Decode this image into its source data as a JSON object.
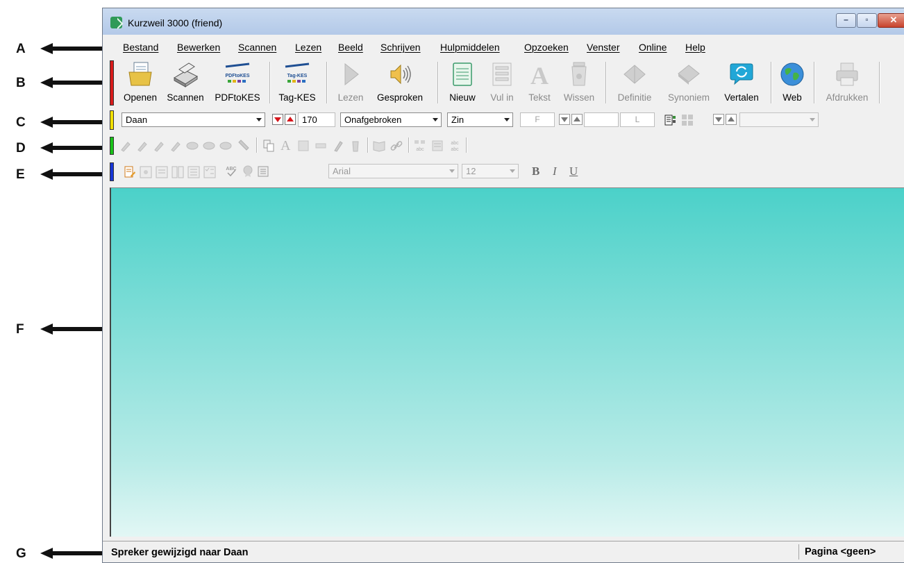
{
  "annotations": [
    "A",
    "B",
    "C",
    "D",
    "E",
    "F",
    "G"
  ],
  "window": {
    "title": "Kurzweil 3000 (friend)"
  },
  "menu": [
    "Bestand",
    "Bewerken",
    "Scannen",
    "Lezen",
    "Beeld",
    "Schrijven",
    "Hulpmiddelen",
    "Opzoeken",
    "Venster",
    "Online",
    "Help"
  ],
  "toolbar": {
    "buttons": [
      {
        "label": "Openen",
        "icon": "open-folder-icon",
        "enabled": true
      },
      {
        "label": "Scannen",
        "icon": "scanner-icon",
        "enabled": true
      },
      {
        "label": "PDFtoKES",
        "icon": "pdftokes-icon",
        "icon_text": "PDFtoKES",
        "enabled": true
      },
      {
        "label": "Tag-KES",
        "icon": "tagkes-icon",
        "icon_text": "Tag-KES",
        "enabled": true
      },
      {
        "label": "Lezen",
        "icon": "play-icon",
        "enabled": false
      },
      {
        "label": "Gesproken",
        "icon": "speaker-icon",
        "enabled": true
      },
      {
        "label": "Nieuw",
        "icon": "new-document-icon",
        "enabled": true
      },
      {
        "label": "Vul in",
        "icon": "fill-in-icon",
        "enabled": false
      },
      {
        "label": "Tekst",
        "icon": "text-icon",
        "enabled": false
      },
      {
        "label": "Wissen",
        "icon": "trash-icon",
        "enabled": false
      },
      {
        "label": "Definitie",
        "icon": "definition-icon",
        "enabled": false
      },
      {
        "label": "Synoniem",
        "icon": "synonym-icon",
        "enabled": false
      },
      {
        "label": "Vertalen",
        "icon": "translate-icon",
        "enabled": true
      },
      {
        "label": "Web",
        "icon": "globe-icon",
        "enabled": true
      },
      {
        "label": "Afdrukken",
        "icon": "printer-icon",
        "enabled": false
      }
    ]
  },
  "reading": {
    "voice": "Daan",
    "speed": "170",
    "mode": "Onafgebroken",
    "unit": "Zin",
    "field_f": "F",
    "field_l": "L"
  },
  "formatting": {
    "font": "Arial",
    "size": "12",
    "bold": "B",
    "italic": "I",
    "underline": "U"
  },
  "status": {
    "message": "Spreker gewijzigd naar Daan",
    "page": "Pagina <geen>"
  },
  "colors": {
    "doc_top": "#4bd1c9",
    "doc_bottom": "#e2f7f5",
    "grip_b": "#d81b1b",
    "grip_c": "#f2e000",
    "grip_d": "#19c219",
    "grip_e": "#1736d6"
  }
}
